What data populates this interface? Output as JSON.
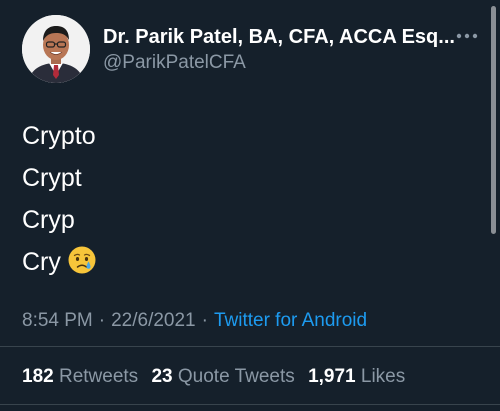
{
  "author": {
    "display_name": "Dr. Parik Patel, BA, CFA, ACCA Esq...",
    "handle": "@ParikPatelCFA"
  },
  "tweet": {
    "lines": [
      "Crypto",
      "Crypt",
      "Cryp",
      "Cry"
    ],
    "emoji": "crying-face"
  },
  "meta": {
    "time": "8:54 PM",
    "separator": "·",
    "date": "22/6/2021",
    "source": "Twitter for Android"
  },
  "stats": {
    "retweets_count": "182",
    "retweets_label": "Retweets",
    "quotes_count": "23",
    "quotes_label": "Quote Tweets",
    "likes_count": "1,971",
    "likes_label": "Likes"
  },
  "colors": {
    "background": "#15202b",
    "text": "#ffffff",
    "secondary_text": "#8b98a5",
    "link": "#1d9bf0",
    "divider": "#38444d"
  },
  "icons": [
    "avatar",
    "more-icon",
    "crying-face-emoji"
  ]
}
